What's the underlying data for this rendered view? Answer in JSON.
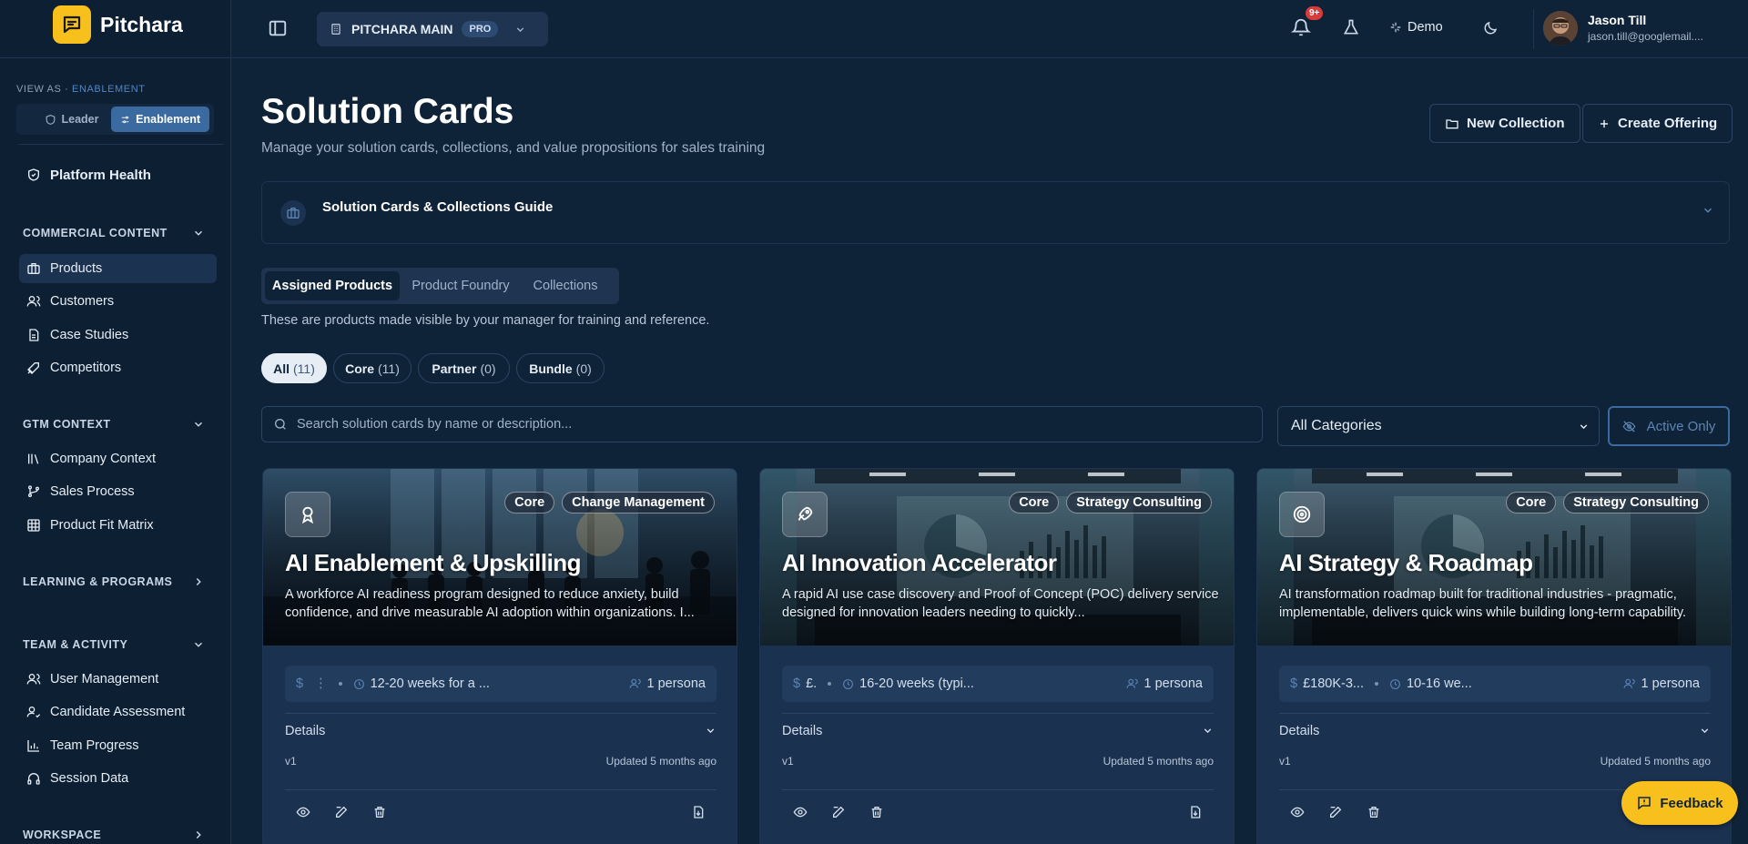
{
  "app": {
    "name": "Pitchara"
  },
  "sidebar": {
    "view_as_label": "VIEW AS · ",
    "view_as_value": "ENABLEMENT",
    "roles": {
      "leader": "Leader",
      "enablement": "Enablement"
    },
    "platform_health": "Platform Health",
    "sections": {
      "commercial": "COMMERCIAL CONTENT",
      "gtm": "GTM CONTEXT",
      "learning": "LEARNING & PROGRAMS",
      "team": "TEAM & ACTIVITY",
      "workspace": "WORKSPACE"
    },
    "commercial_items": [
      "Products",
      "Customers",
      "Case Studies",
      "Competitors"
    ],
    "gtm_items": [
      "Company Context",
      "Sales Process",
      "Product Fit Matrix"
    ],
    "team_items": [
      "User Management",
      "Candidate Assessment",
      "Team Progress",
      "Session Data"
    ]
  },
  "topbar": {
    "workspace_name": "PITCHARA MAIN",
    "plan_badge": "PRO",
    "notifications": "9+",
    "demo_label": "Demo",
    "user_name": "Jason Till",
    "user_email": "jason.till@googlemail...."
  },
  "page": {
    "title": "Solution Cards",
    "subtitle": "Manage your solution cards, collections, and value propositions for sales training",
    "new_collection": "New Collection",
    "create_offering": "Create Offering",
    "guide_title": "Solution Cards & Collections Guide",
    "tabs": [
      "Assigned Products",
      "Product Foundry",
      "Collections"
    ],
    "tabs_note": "These are products made visible by your manager for training and reference.",
    "filters": [
      {
        "label": "All",
        "count": "(11)"
      },
      {
        "label": "Core",
        "count": "(11)"
      },
      {
        "label": "Partner",
        "count": "(0)"
      },
      {
        "label": "Bundle",
        "count": "(0)"
      }
    ],
    "search_placeholder": "Search solution cards by name or description...",
    "category_select": "All Categories",
    "active_only": "Active Only"
  },
  "cards": [
    {
      "title": "AI Enablement & Upskilling",
      "description": "A workforce AI readiness program designed to reduce anxiety, build confidence, and drive measurable AI adoption within organizations. I...",
      "tags": [
        "Core",
        "Change Management"
      ],
      "price": "$",
      "price_value": "",
      "duration": "12-20 weeks for a ...",
      "personas": "1 persona",
      "details_label": "Details",
      "version": "v1",
      "updated": "Updated 5 months ago",
      "icon": "award-icon"
    },
    {
      "title": "AI Innovation Accelerator",
      "description": "A rapid AI use case discovery and Proof of Concept (POC) delivery service designed for innovation leaders needing to quickly...",
      "tags": [
        "Core",
        "Strategy Consulting"
      ],
      "price": "$",
      "price_value": "£.",
      "duration": "16-20 weeks (typi...",
      "personas": "1 persona",
      "details_label": "Details",
      "version": "v1",
      "updated": "Updated 5 months ago",
      "icon": "rocket-icon"
    },
    {
      "title": "AI Strategy & Roadmap",
      "description": "AI transformation roadmap built for traditional industries - pragmatic, implementable, delivers quick wins while building long-term capability.",
      "tags": [
        "Core",
        "Strategy Consulting"
      ],
      "price": "$",
      "price_value": "£180K-3...",
      "duration": "10-16 we...",
      "personas": "1 persona",
      "details_label": "Details",
      "version": "v1",
      "updated": "Updated 5 months ago",
      "icon": "target-icon"
    }
  ],
  "feedback_label": "Feedback"
}
